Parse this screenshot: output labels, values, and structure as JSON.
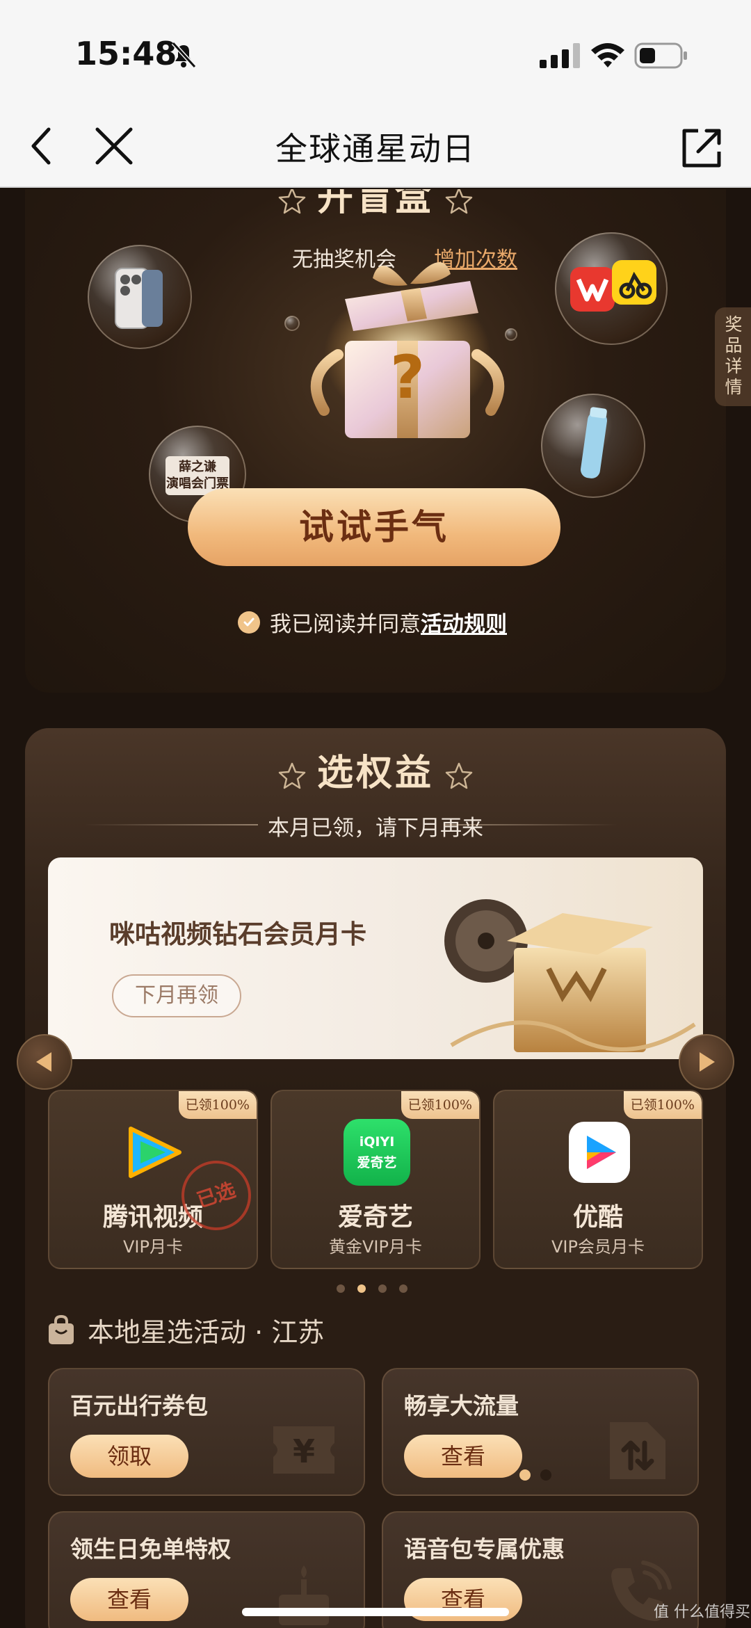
{
  "status_bar": {
    "time": "15:48"
  },
  "nav": {
    "title": "全球通星动日"
  },
  "blind_box": {
    "title": "开盲盒",
    "no_chance": "无抽奖机会",
    "add_count": "增加次数",
    "concert_ticket": "薛之谦\n演唱会门票",
    "try_button": "试试手气",
    "agree_prefix": "我已阅读并同意",
    "agree_link": "活动规则",
    "side_tab": "奖品详情"
  },
  "rights": {
    "title": "选权益",
    "month_note": "本月已领，请下月再来",
    "banner": {
      "title": "咪咕视频钻石会员月卡",
      "button": "下月再领"
    },
    "vip_cards": [
      {
        "badge": "已领100%",
        "name": "腾讯视频",
        "sub": "VIP月卡",
        "stamp": "已选"
      },
      {
        "badge": "已领100%",
        "name": "爱奇艺",
        "sub": "黄金VIP月卡",
        "logo_text": "iQIYI\n爱奇艺"
      },
      {
        "badge": "已领100%",
        "name": "优酷",
        "sub": "VIP会员月卡"
      }
    ],
    "dots_active_index": 1,
    "local_title": "本地星选活动 · 江苏",
    "activities": [
      {
        "title": "百元出行券包",
        "button": "领取",
        "icon": "yuan-ticket-icon"
      },
      {
        "title": "畅享大流量",
        "button": "查看",
        "icon": "data-flow-icon"
      },
      {
        "title": "领生日免单特权",
        "button": "查看",
        "icon": "birthday-cake-icon"
      },
      {
        "title": "语音包专属优惠",
        "button": "查看",
        "icon": "phone-icon"
      }
    ]
  },
  "watermark": "值 什么值得买",
  "colors": {
    "accent_gold": "#f0c48a",
    "button_text": "#6b2e12",
    "background": "#1c130d"
  }
}
